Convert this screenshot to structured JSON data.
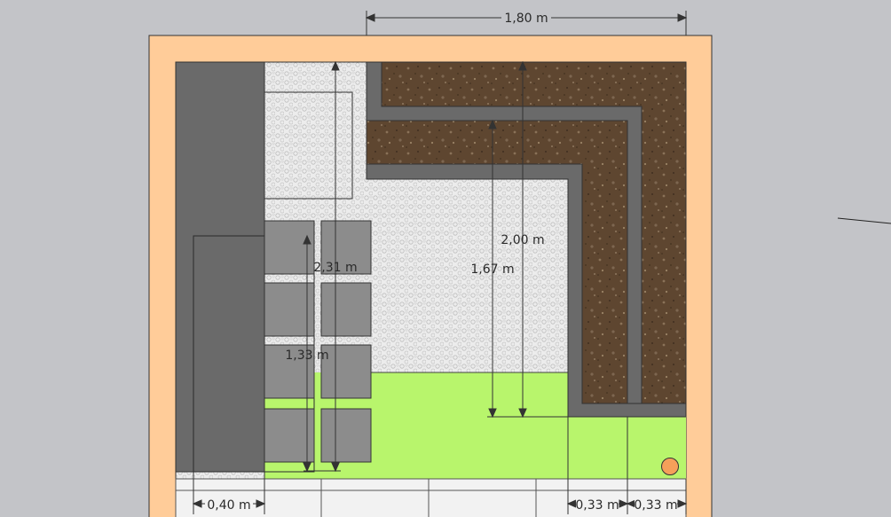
{
  "dimensions": {
    "top_width": "1,80 m",
    "pebble_depth": "2,31 m",
    "inner_depth": "2,00 m",
    "inner_height": "1,67 m",
    "steps_depth": "1,33 m",
    "wall_width": "0,40 m",
    "bed_width_1": "0,33 m",
    "bed_width_2": "0,33 m"
  },
  "colors": {
    "background": "#c3c4c8",
    "boundary": "#ffcc99",
    "wall": "#6a6a6a",
    "gravel": "#ececec",
    "soil": "#5e4630",
    "lawn": "#b8f56c",
    "paving": "#f2f2f2",
    "stepping_stone": "#8c8c8c",
    "marker": "#f5a05a"
  }
}
